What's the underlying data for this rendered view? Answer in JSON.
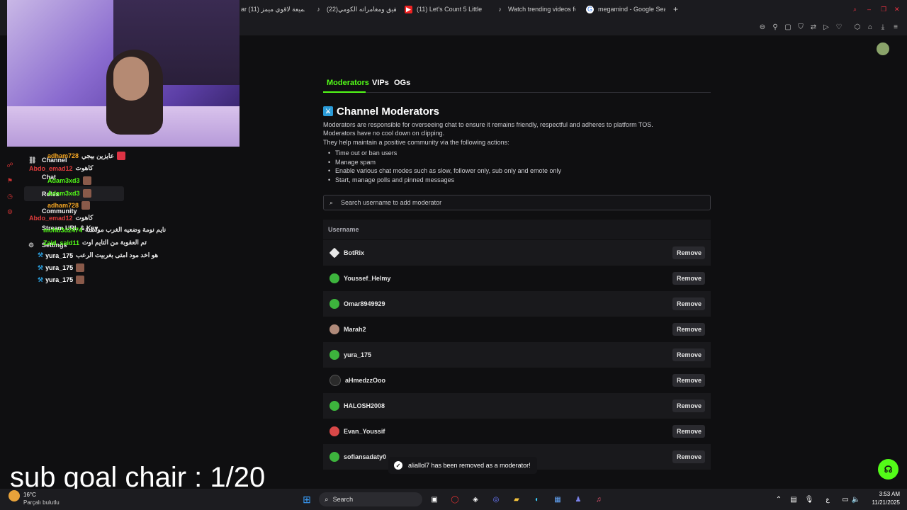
{
  "browser": {
    "tabs": [
      {
        "label": "ar (11) تجميعة لاقوي ميمز",
        "icon": "generic-icon"
      },
      {
        "label": "(22)شقيق ومغامراته الكومي",
        "icon": "tiktok-icon"
      },
      {
        "label": "(11) Let's Count 5 Little Du",
        "icon": "youtube-icon"
      },
      {
        "label": "Watch trending videos fo",
        "icon": "tiktok-icon"
      },
      {
        "label": "megamind - Google Search",
        "icon": "google-icon"
      }
    ],
    "new_tab": "+"
  },
  "settings": {
    "tabs": [
      {
        "label": "Moderators",
        "active": true
      },
      {
        "label": "VIPs",
        "active": false
      },
      {
        "label": "OGs",
        "active": false
      }
    ],
    "title": "Channel Moderators",
    "description": [
      "Moderators are responsible for overseeing chat to ensure it remains friendly, respectful and adheres to platform TOS.",
      "Moderators have no cool down on clipping.",
      "They help maintain a positive community via the following actions:"
    ],
    "actions": [
      "Time out or ban users",
      "Manage spam",
      "Enable various chat modes such as slow, follower only, sub only and emote only",
      "Start, manage polls and pinned messages"
    ],
    "search_placeholder": "Search username to add moderator",
    "column_header": "Username",
    "remove_label": "Remove",
    "moderators": [
      {
        "name": "BotRix",
        "avatar_color": "#e8e8e8"
      },
      {
        "name": "Youssef_Helmy",
        "avatar_color": "#3db43d"
      },
      {
        "name": "Omar8949929",
        "avatar_color": "#3db43d"
      },
      {
        "name": "Marah2",
        "avatar_color": "#b08a7a"
      },
      {
        "name": "yura_175",
        "avatar_color": "#3db43d"
      },
      {
        "name": "aHmedzzOoo",
        "avatar_color": "#222222"
      },
      {
        "name": "HALOSH2008",
        "avatar_color": "#3db43d"
      },
      {
        "name": "Evan_Youssif",
        "avatar_color": "#d94848"
      },
      {
        "name": "sofiansadaty0",
        "avatar_color": "#3db43d"
      }
    ]
  },
  "sidebar_nav": [
    "Channel",
    "Chat",
    "Roles",
    "Community",
    "Stream URL & Key",
    "Settings"
  ],
  "chat": [
    {
      "user": "adham728",
      "msg": "عايزين بيجي",
      "color": "#f5a623"
    },
    {
      "user": "Abdo_emad12",
      "msg": "كاهوت",
      "color": "#e23c3c"
    },
    {
      "user": "Adam3xd3",
      "msg": "",
      "color": "#53fc18"
    },
    {
      "user": "Adam3xd3",
      "msg": "",
      "color": "#53fc18"
    },
    {
      "user": "adham728",
      "msg": "",
      "color": "#f5a623"
    },
    {
      "user": "Abdo_emad12",
      "msg": "كاهوت",
      "color": "#e23c3c"
    },
    {
      "user": "mohb3d2474",
      "msg": "نايم نومة وضعيه الغرب مواطنة",
      "color": "#53fc18"
    },
    {
      "user": "Zaid_said11",
      "msg": "تم العقوبة من التايم اوت",
      "color": "#53fc18"
    },
    {
      "user": "yura_175",
      "msg": "هو اخد مود امتى بغربيت الرعب",
      "color": "#ffffff"
    },
    {
      "user": "yura_175",
      "msg": "",
      "color": "#ffffff"
    },
    {
      "user": "yura_175",
      "msg": "",
      "color": "#ffffff"
    }
  ],
  "toast": "aliallol7 has been removed as a moderator!",
  "overlay_goal": "sub goal chair : 1/20",
  "taskbar": {
    "weather_temp": "16°C",
    "weather_desc": "Parçalı bulutlu",
    "search": "Search",
    "lang": "ع",
    "time": "3:53 AM",
    "date": "11/21/2025"
  },
  "colors": {
    "accent": "#53fc18",
    "background": "#0f0f11",
    "row_alt": "#19191c"
  }
}
